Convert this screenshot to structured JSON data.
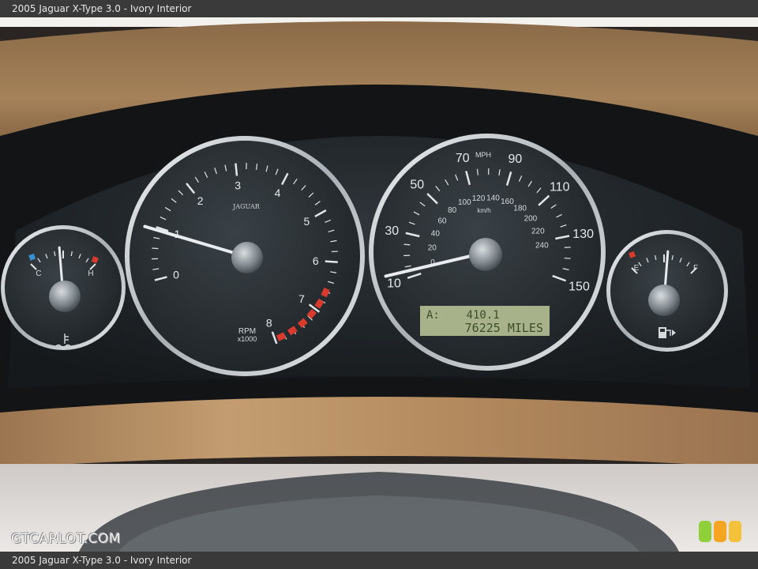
{
  "header": {
    "caption": "2005 Jaguar X-Type 3.0 - Ivory Interior"
  },
  "footer": {
    "caption": "2005 Jaguar X-Type 3.0 - Ivory Interior"
  },
  "watermark": {
    "text": "GTCARLOT.COM"
  },
  "status_lights": [
    "#8fcf3a",
    "#f4a623",
    "#f3c13a"
  ],
  "tachometer": {
    "brand": "JAGUAR",
    "label": "RPM",
    "unit": "x1000",
    "ticks": [
      "0",
      "1",
      "2",
      "3",
      "4",
      "5",
      "6",
      "7",
      "8"
    ],
    "needle_value": 0.95
  },
  "speedometer": {
    "unit_label": "MPH",
    "km_label": "km/h",
    "mph_ticks": [
      "10",
      "30",
      "50",
      "70",
      "90",
      "110",
      "130",
      "150"
    ],
    "kmh_ticks": [
      "0",
      "20",
      "40",
      "60",
      "80",
      "100",
      "120",
      "140",
      "160",
      "180",
      "200",
      "220",
      "240"
    ],
    "needle_value": 3,
    "trip": "A:    410.1",
    "odometer": "76225 MILES"
  },
  "temp_gauge": {
    "cold": "C",
    "hot": "H",
    "needle_value": 0.45
  },
  "fuel_gauge": {
    "empty": "E",
    "full": "F",
    "needle_value": 0.55
  },
  "colors": {
    "display_bg": "#a7b28a",
    "display_text": "#3b4d2a",
    "redline": "#d83b2e",
    "wood": "#a7825a"
  }
}
